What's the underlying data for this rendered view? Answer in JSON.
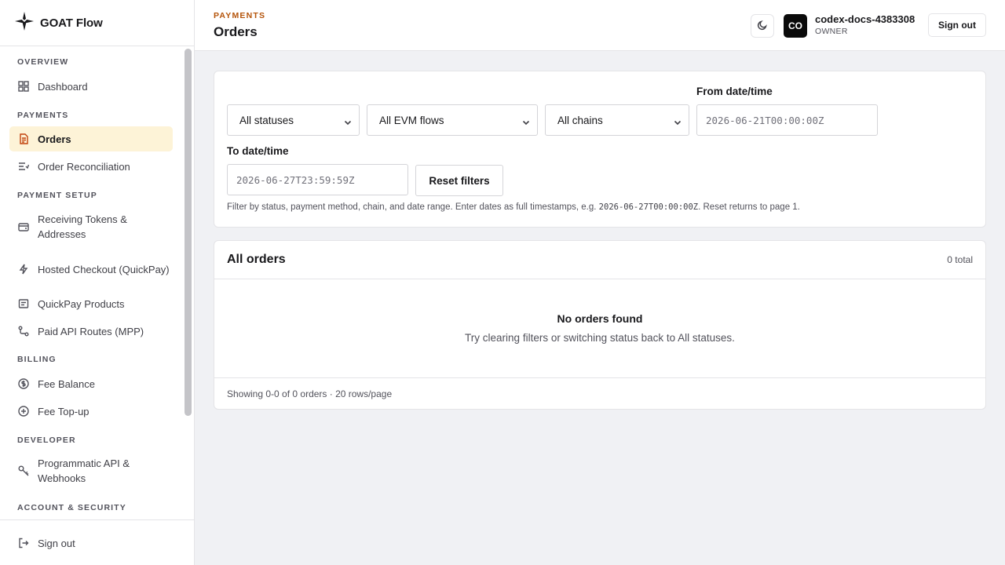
{
  "app": {
    "name": "GOAT Flow"
  },
  "sidebar": {
    "sections": {
      "overview": "OVERVIEW",
      "payments": "PAYMENTS",
      "payment_setup": "PAYMENT SETUP",
      "billing": "BILLING",
      "developer": "DEVELOPER",
      "account_security": "ACCOUNT & SECURITY"
    },
    "items": {
      "dashboard": {
        "label": "Dashboard",
        "icon": "grid-icon"
      },
      "orders": {
        "label": "Orders",
        "icon": "document-icon",
        "active": true
      },
      "order_reconciliation": {
        "label": "Order Reconciliation",
        "icon": "list-check-icon"
      },
      "receiving_tokens": {
        "label": "Receiving Tokens & Addresses",
        "icon": "wallet-icon"
      },
      "hosted_checkout": {
        "label": "Hosted Checkout (QuickPay)",
        "icon": "lightning-icon"
      },
      "quickpay_products": {
        "label": "QuickPay Products",
        "icon": "product-list-icon"
      },
      "paid_api_routes": {
        "label": "Paid API Routes (MPP)",
        "icon": "route-icon"
      },
      "fee_balance": {
        "label": "Fee Balance",
        "icon": "coin-icon"
      },
      "fee_topup": {
        "label": "Fee Top-up",
        "icon": "plus-circle-icon"
      },
      "programmatic_api": {
        "label": "Programmatic API & Webhooks",
        "icon": "key-icon"
      }
    },
    "footer": {
      "signout_label": "Sign out",
      "icon": "logout-icon"
    }
  },
  "header": {
    "breadcrumb": "PAYMENTS",
    "title": "Orders",
    "user": {
      "initials": "CO",
      "name": "codex-docs-4383308",
      "role": "OWNER"
    },
    "signout_label": "Sign out"
  },
  "filters": {
    "status": {
      "selected": "All statuses"
    },
    "flow": {
      "selected": "All EVM flows"
    },
    "chain": {
      "selected": "All chains"
    },
    "from": {
      "label": "From date/time",
      "placeholder": "2026-06-21T00:00:00Z"
    },
    "to": {
      "label": "To date/time",
      "placeholder": "2026-06-27T23:59:59Z"
    },
    "reset_label": "Reset filters",
    "hint_before": "Filter by status, payment method, chain, and date range. Enter dates as full timestamps, e.g. ",
    "hint_code": "2026-06-27T00:00:00Z",
    "hint_after": ". Reset returns to page 1."
  },
  "orders": {
    "title": "All orders",
    "total": "0 total",
    "empty_title": "No orders found",
    "empty_subtitle": "Try clearing filters or switching status back to All statuses.",
    "footer": "Showing 0-0 of 0 orders · 20 rows/page"
  },
  "colors": {
    "accent": "#b45309",
    "active_bg": "#fdf3d7",
    "page_bg": "#f0f1f4"
  }
}
